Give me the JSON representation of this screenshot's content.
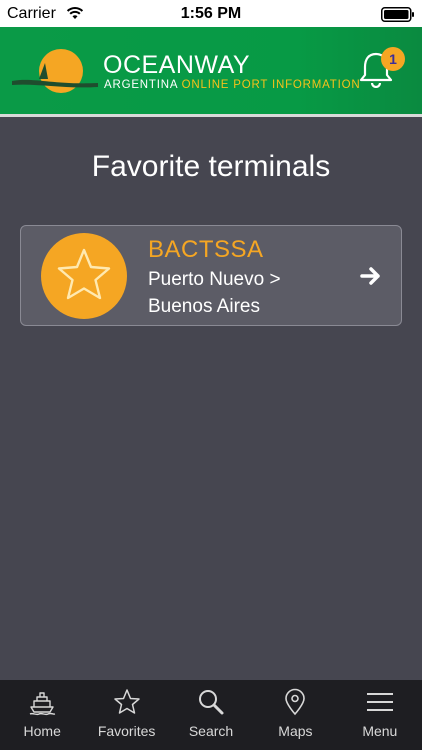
{
  "status_bar": {
    "carrier": "Carrier",
    "time": "1:56 PM"
  },
  "header": {
    "brand": "OCEANWAY",
    "tagline_country": "ARGENTINA",
    "tagline_rest": "ONLINE PORT INFORMATION",
    "notification_count": "1",
    "colors": {
      "background": "#0a9a47",
      "accent": "#f5c21b"
    }
  },
  "main": {
    "title": "Favorite terminals",
    "terminals": [
      {
        "name": "BACTSSA",
        "location": "Puerto Nuevo > Buenos Aires",
        "icon": "star-icon"
      }
    ]
  },
  "tabs": [
    {
      "label": "Home",
      "icon": "ship-icon"
    },
    {
      "label": "Favorites",
      "icon": "star-icon"
    },
    {
      "label": "Search",
      "icon": "search-icon"
    },
    {
      "label": "Maps",
      "icon": "map-pin-icon"
    },
    {
      "label": "Menu",
      "icon": "menu-icon"
    }
  ]
}
